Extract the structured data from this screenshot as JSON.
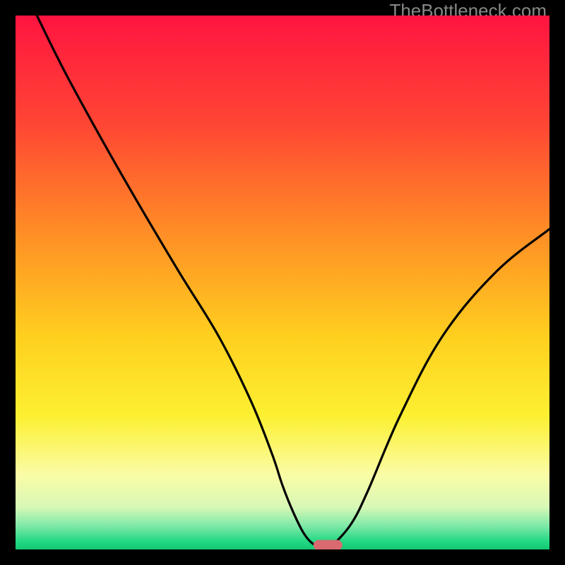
{
  "watermark": "TheBottleneck.com",
  "chart_data": {
    "type": "line",
    "title": "",
    "xlabel": "",
    "ylabel": "",
    "xlim": [
      0,
      100
    ],
    "ylim": [
      0,
      100
    ],
    "grid": false,
    "legend": false,
    "series": [
      {
        "name": "bottleneck-curve",
        "x": [
          4,
          10,
          20,
          30,
          38,
          44,
          48,
          50,
          52,
          54,
          55.8,
          57,
          58,
          59,
          60,
          63,
          66,
          72,
          80,
          90,
          100
        ],
        "y": [
          100,
          88,
          70,
          53,
          40,
          28,
          18,
          12,
          7,
          3,
          1,
          1,
          1,
          1,
          1.4,
          5,
          11,
          25,
          40,
          52,
          60
        ]
      }
    ],
    "marker": {
      "name": "optimal-zone-pill",
      "x_range": [
        55.8,
        61.2
      ],
      "y": 0.8,
      "color": "#d96a6f"
    },
    "background_gradient": {
      "type": "vertical",
      "stops": [
        {
          "pos": 0.0,
          "color": "#ff1440"
        },
        {
          "pos": 0.2,
          "color": "#ff4534"
        },
        {
          "pos": 0.4,
          "color": "#ff8b26"
        },
        {
          "pos": 0.6,
          "color": "#ffcf1f"
        },
        {
          "pos": 0.75,
          "color": "#fcf031"
        },
        {
          "pos": 0.86,
          "color": "#fafca6"
        },
        {
          "pos": 0.92,
          "color": "#d8f8b6"
        },
        {
          "pos": 0.955,
          "color": "#80e9a8"
        },
        {
          "pos": 0.985,
          "color": "#22d883"
        },
        {
          "pos": 1.0,
          "color": "#14c873"
        }
      ]
    }
  }
}
